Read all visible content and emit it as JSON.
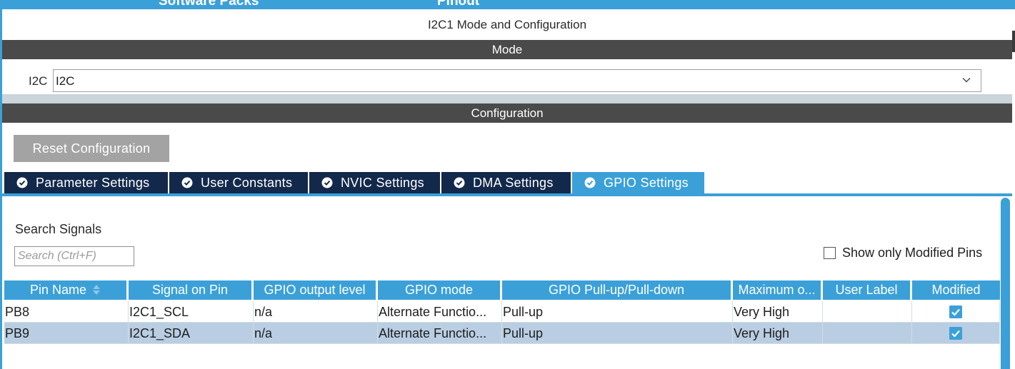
{
  "top_tabs": [
    {
      "label": "Software Packs"
    },
    {
      "label": "Pinout"
    }
  ],
  "panel": {
    "title": "I2C1 Mode and Configuration",
    "mode_section": "Mode",
    "config_section": "Configuration"
  },
  "mode": {
    "field_label": "I2C",
    "selected_value": "I2C"
  },
  "reset_button": "Reset Configuration",
  "config_tabs": [
    {
      "label": "Parameter Settings",
      "active": false
    },
    {
      "label": "User Constants",
      "active": false
    },
    {
      "label": "NVIC Settings",
      "active": false
    },
    {
      "label": "DMA Settings",
      "active": false
    },
    {
      "label": "GPIO Settings",
      "active": true
    }
  ],
  "search": {
    "title": "Search Signals",
    "placeholder": "Search (Ctrl+F)"
  },
  "show_modified": {
    "label": "Show only Modified Pins",
    "checked": false
  },
  "table": {
    "columns": [
      "Pin Name",
      "Signal on Pin",
      "GPIO output level",
      "GPIO mode",
      "GPIO Pull-up/Pull-down",
      "Maximum o...",
      "User Label",
      "Modified"
    ],
    "rows": [
      {
        "pin": "PB8",
        "signal": "I2C1_SCL",
        "output_level": "n/a",
        "mode": "Alternate Functio...",
        "pull": "Pull-up",
        "max_speed": "Very High",
        "user_label": "",
        "modified": true,
        "selected": false
      },
      {
        "pin": "PB9",
        "signal": "I2C1_SDA",
        "output_level": "n/a",
        "mode": "Alternate Functio...",
        "pull": "Pull-up",
        "max_speed": "Very High",
        "user_label": "",
        "modified": true,
        "selected": true
      }
    ]
  },
  "colors": {
    "accent": "#3ba0d8",
    "tab_dark": "#13294b",
    "section_bar": "#4a4a4a",
    "selected_row": "#b9cee2",
    "button_gray": "#a3a3a3"
  }
}
